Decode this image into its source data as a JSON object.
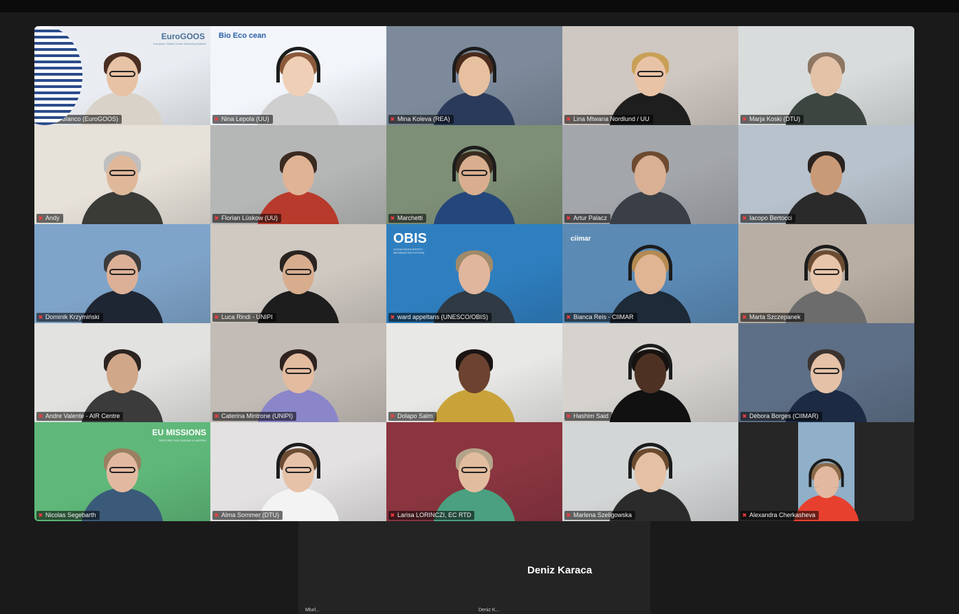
{
  "meeting": {
    "active_speaker": "Deniz Karaca",
    "bottom_left_partial": "Mlurl...",
    "bottom_right_partial": "Deniz K..."
  },
  "logos": {
    "eurogoos": "EuroGOOS",
    "eurogoos_sub": "European Global Ocean Observing System",
    "bioecocean": "Bio Eco cean",
    "obis": "OBIS",
    "obis_sub": "OCEAN BIODIVERSITY INFORMATION SYSTEM",
    "ciimar": "ciimar",
    "missions": "EU MISSIONS",
    "missions_sub": "RESTORE OUR OCEANS & WATERS"
  },
  "participants": [
    {
      "name": "Alicia Blanco (EuroGOOS)",
      "bg": "#e9edf2",
      "skin": "#e8c2a4",
      "hair": "#4a2e22",
      "shirt": "#d9d2c8",
      "glasses": true
    },
    {
      "name": "Nina Lepola (UU)",
      "bg": "#f2f6fb",
      "skin": "#efcfb6",
      "hair": "#8b5a3a",
      "shirt": "#cfcfcf",
      "headset": true
    },
    {
      "name": "Mina Koleva (REA)",
      "bg": "#7c8a9b",
      "skin": "#e7c09f",
      "hair": "#4a2b1c",
      "shirt": "#2a3a5a",
      "headset": true
    },
    {
      "name": "Lina Mtwana Nordlund / UU",
      "bg": "#cfc7c1",
      "skin": "#e9c3a5",
      "hair": "#c9a057",
      "shirt": "#1e1e1e",
      "glasses": true,
      "active": true
    },
    {
      "name": "Marja Koski (DTU)",
      "bg": "#d8dcdc",
      "skin": "#e4c2a8",
      "hair": "#8d7663",
      "shirt": "#3c4540"
    },
    {
      "name": "Andy",
      "bg": "#e6e1d9",
      "skin": "#dfb89a",
      "hair": "#bfbfbf",
      "shirt": "#3a3a36",
      "glasses": true
    },
    {
      "name": "Florian Lüskow (UU)",
      "bg": "#b5b7b6",
      "skin": "#e0b395",
      "hair": "#3a2a20",
      "shirt": "#b83a2c"
    },
    {
      "name": "Marchetti",
      "bg": "#7d8f76",
      "skin": "#d8ae8e",
      "hair": "#3a2b1f",
      "shirt": "#25467a",
      "glasses": true,
      "headset": true
    },
    {
      "name": "Artur Palacz",
      "bg": "#a3a6ab",
      "skin": "#d9b094",
      "hair": "#6d4a30",
      "shirt": "#3a3f47"
    },
    {
      "name": "Iacopo Bertocci",
      "bg": "#b8c2cc",
      "skin": "#c99a78",
      "hair": "#2a2320",
      "shirt": "#2a2a2a"
    },
    {
      "name": "Dominik Krzymiński",
      "bg": "#7fa4c9",
      "skin": "#dcb097",
      "hair": "#3b3b3b",
      "shirt": "#1f2633",
      "glasses": true
    },
    {
      "name": "Luca Rindi - UNIPI",
      "bg": "#cfc9c2",
      "skin": "#d7ad8e",
      "hair": "#2a2420",
      "shirt": "#1d1d1d",
      "glasses": true
    },
    {
      "name": "ward appeltans (UNESCO/OBIS)",
      "bg": "#2f7fc0",
      "skin": "#e0b69c",
      "hair": "#a08a6a",
      "shirt": "#2f3a44"
    },
    {
      "name": "Bianca Reis - CIIMAR",
      "bg": "#5b8ab5",
      "skin": "#e0b594",
      "hair": "#b48a52",
      "shirt": "#1d2a38",
      "headset": true
    },
    {
      "name": "Marta Szczepanek",
      "bg": "#b9aea3",
      "skin": "#e7c5ab",
      "hair": "#6b4c32",
      "shirt": "#6c6c6c",
      "glasses": true,
      "headset": true
    },
    {
      "name": "Andre Valente - AIR Centre",
      "bg": "#e2e2e0",
      "skin": "#d1a789",
      "hair": "#2b2420",
      "shirt": "#3b3b3b"
    },
    {
      "name": "Caterina Mintrone (UNIPI)",
      "bg": "#c3bcb6",
      "skin": "#e3bb9f",
      "hair": "#2f2320",
      "shirt": "#8a86c9",
      "glasses": true
    },
    {
      "name": "Dolapo Salm",
      "bg": "#e8e8e6",
      "skin": "#6b4330",
      "hair": "#1a1412",
      "shirt": "#c9a33a"
    },
    {
      "name": "Hashim Said",
      "bg": "#d6d3cf",
      "skin": "#4d3224",
      "hair": "#161210",
      "shirt": "#111111",
      "headset": true
    },
    {
      "name": "Débora Borges (CIIMAR)",
      "bg": "#5d6f86",
      "skin": "#e4c1a7",
      "hair": "#3a3330",
      "shirt": "#1d2a44",
      "glasses": true
    },
    {
      "name": "Nicolas Segebarth",
      "bg": "#5fb87a",
      "skin": "#e2b9a0",
      "hair": "#9a8060",
      "shirt": "#3b5a7a",
      "glasses": true
    },
    {
      "name": "Alma Sommer (DTU)",
      "bg": "#e3e1e1",
      "skin": "#e6c2a8",
      "hair": "#6c4d34",
      "shirt": "#f3f3f3",
      "glasses": true,
      "headset": true
    },
    {
      "name": "Larisa LORINCZI, EC RTD",
      "bg": "#8a3540",
      "skin": "#e2bc9e",
      "hair": "#b4a38a",
      "shirt": "#4aa080",
      "glasses": true
    },
    {
      "name": "Marlena Szeligowska",
      "bg": "#d3d6d6",
      "skin": "#e6c0a4",
      "hair": "#6a4a2e",
      "shirt": "#2b2b2b",
      "headset": true
    },
    {
      "name": "Alexandra Cherkasheva",
      "bg": "#2a2a2a",
      "skin": "#e2b9a0",
      "hair": "#8b6a4a",
      "shirt": "#e8402f",
      "headset": true,
      "narrow": true
    }
  ]
}
